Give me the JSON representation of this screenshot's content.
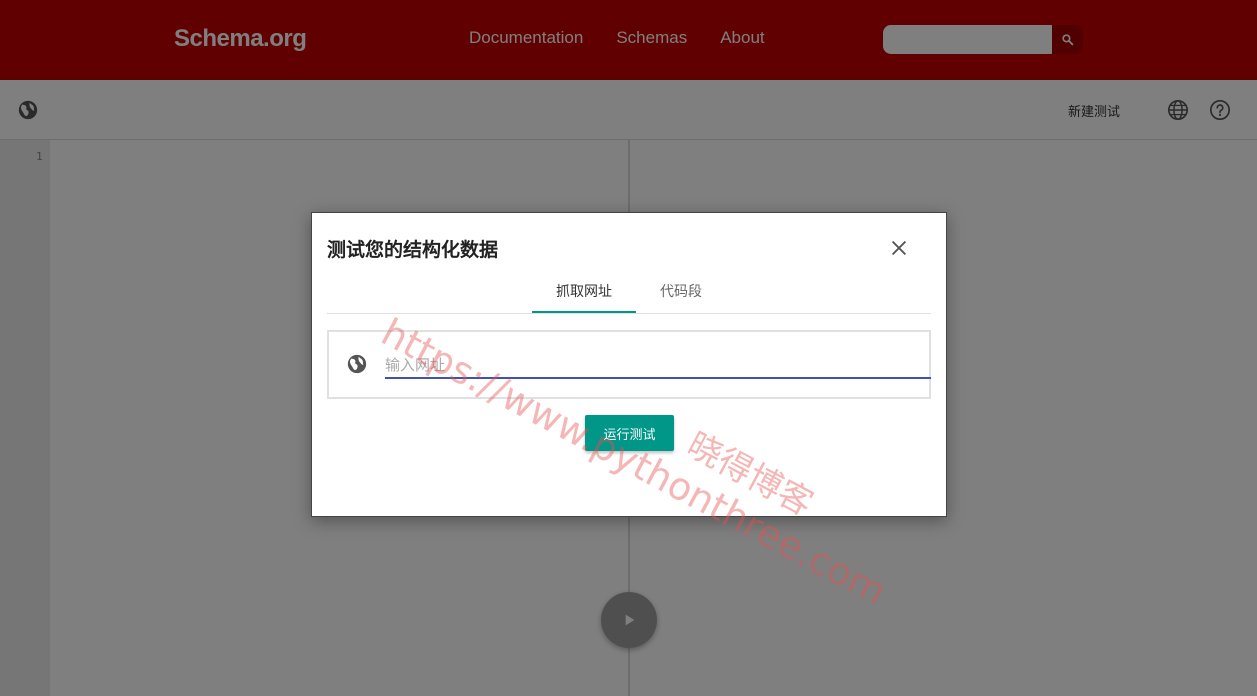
{
  "header": {
    "logo": "Schema.org",
    "nav": [
      "Documentation",
      "Schemas",
      "About"
    ],
    "search": {
      "placeholder": "",
      "button_icon": "search-icon"
    }
  },
  "toolbar": {
    "left_icon": "globe-icon",
    "new_test_label": "新建测试",
    "language_icon": "language-icon",
    "help_icon": "help-icon"
  },
  "editor": {
    "line_numbers": [
      "1"
    ],
    "run_icon": "play-icon"
  },
  "dialog": {
    "title": "测试您的结构化数据",
    "close_icon": "close-icon",
    "tabs": [
      {
        "label": "抓取网址",
        "active": true
      },
      {
        "label": "代码段",
        "active": false
      }
    ],
    "url_field": {
      "icon": "globe-icon",
      "placeholder": "输入网址",
      "value": ""
    },
    "run_button_label": "运行测试"
  },
  "watermark": {
    "url": "https://www.pythonthree.com",
    "name": "晓得博客"
  },
  "colors": {
    "header_bg": "#c00000",
    "accent": "#009688",
    "input_underline": "#3f51b5",
    "watermark": "#e65050"
  }
}
